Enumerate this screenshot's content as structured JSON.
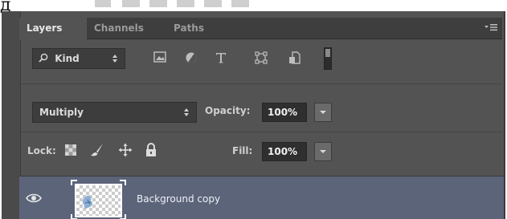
{
  "header_fragment": {
    "text": "д"
  },
  "tabs": [
    {
      "label": "Layers",
      "active": true
    },
    {
      "label": "Channels",
      "active": false
    },
    {
      "label": "Paths",
      "active": false
    }
  ],
  "filter": {
    "kind_label": "Kind",
    "icons": [
      "pixel-filter-icon",
      "adjustment-filter-icon",
      "type-filter-icon",
      "shape-filter-icon",
      "smart-object-filter-icon"
    ]
  },
  "blend": {
    "mode": "Multiply"
  },
  "opacity": {
    "label": "Opacity:",
    "value": "100%"
  },
  "lock": {
    "label": "Lock:",
    "icons": [
      "lock-transparent-pixels-icon",
      "lock-image-pixels-icon",
      "lock-position-icon",
      "lock-all-icon"
    ]
  },
  "fill": {
    "label": "Fill:",
    "value": "100%"
  },
  "layers": [
    {
      "name": "Background copy",
      "visible": true,
      "selected": true
    }
  ],
  "colors": {
    "panel": "#535353",
    "tabbar": "#3e3e3e",
    "selection": "#5b6479"
  }
}
